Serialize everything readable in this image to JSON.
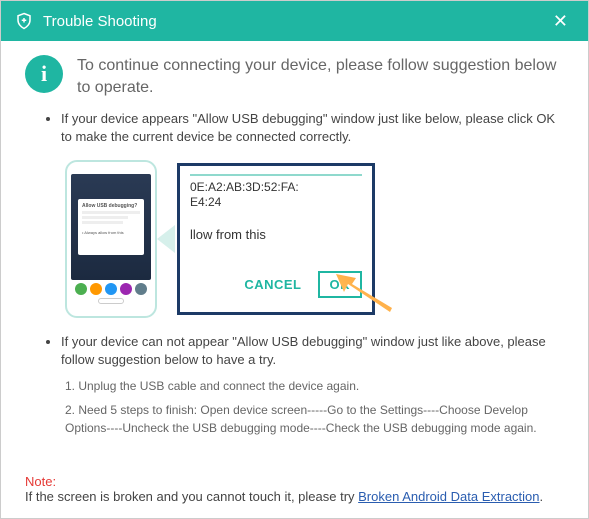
{
  "titlebar": {
    "title": "Trouble Shooting"
  },
  "intro": "To continue connecting your device, please follow suggestion below to operate.",
  "bullet1": "If your device appears \"Allow USB debugging\" window just like below, please click OK to make the current device  be connected correctly.",
  "phone_popup_title": "Allow USB debugging?",
  "dialog": {
    "mac1": "0E:A2:AB:3D:52:FA:",
    "mac2": "E4:24",
    "allow": "llow from this",
    "cancel": "CANCEL",
    "ok": "OK"
  },
  "bullet2": "If your device can not appear \"Allow USB debugging\" window just like above, please follow suggestion below to have a try.",
  "step1": "1. Unplug the USB cable and connect the device again.",
  "step2": "2. Need 5 steps to finish: Open device screen-----Go to the Settings----Choose Develop Options----Uncheck the USB debugging mode----Check the USB debugging mode again.",
  "note_label": "Note:",
  "note_text": "If the screen is broken and you cannot touch it, please try ",
  "note_link": "Broken Android Data Extraction",
  "note_end": "."
}
